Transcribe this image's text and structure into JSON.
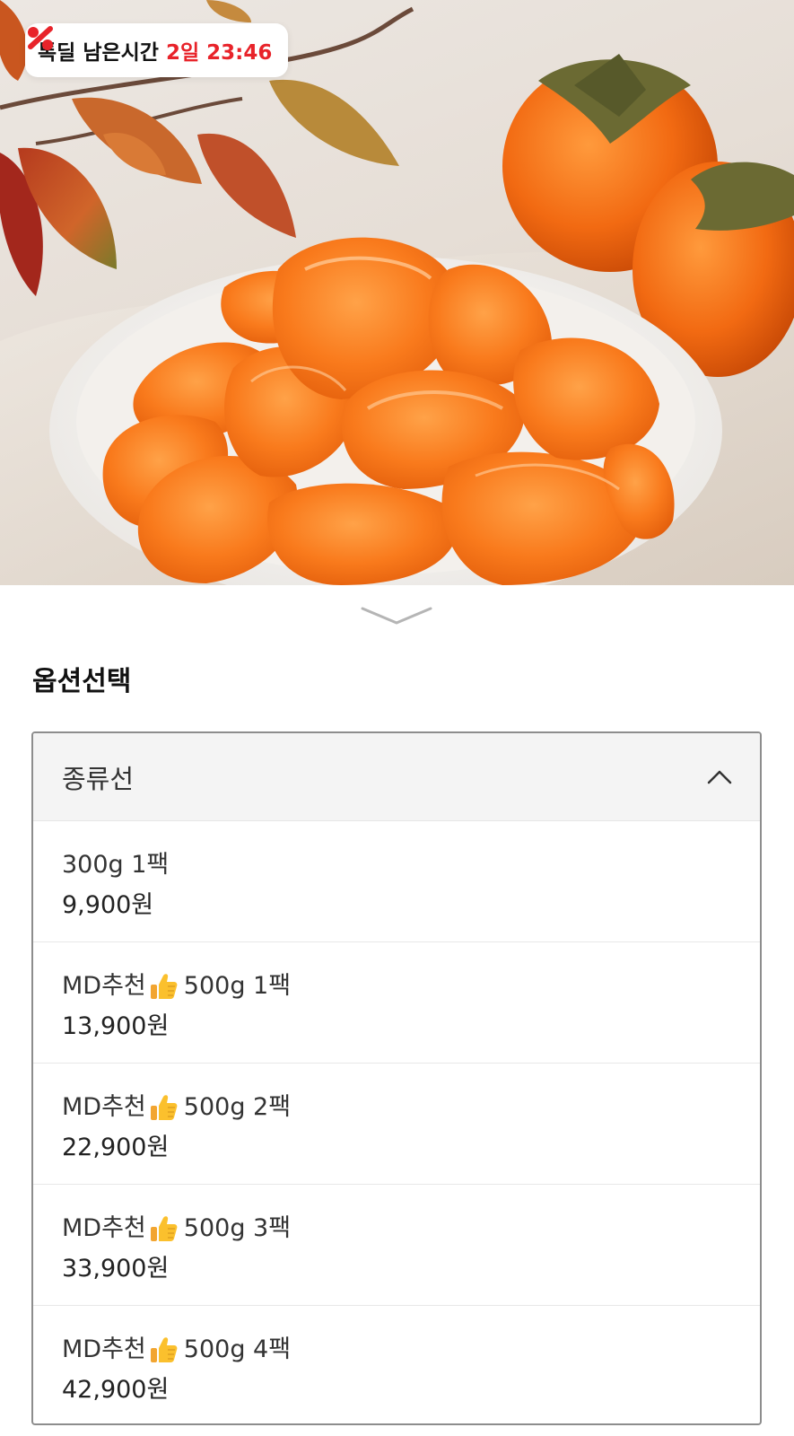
{
  "badge": {
    "label": "톡딜 남은시간",
    "time": "2일 23:46",
    "accent_color": "#e8232a",
    "icon": "percent-icon"
  },
  "expand_icon": "chevron-down-icon",
  "section_title": "옵션선택",
  "dropdown": {
    "label": "종류선",
    "icon": "chevron-up-icon",
    "options": [
      {
        "name_prefix": "",
        "has_thumb": false,
        "name_suffix": "300g 1팩",
        "price": "9,900원"
      },
      {
        "name_prefix": "MD추천",
        "has_thumb": true,
        "name_suffix": "500g 1팩",
        "price": "13,900원"
      },
      {
        "name_prefix": "MD추천",
        "has_thumb": true,
        "name_suffix": "500g 2팩",
        "price": "22,900원"
      },
      {
        "name_prefix": "MD추천",
        "has_thumb": true,
        "name_suffix": "500g 3팩",
        "price": "33,900원"
      },
      {
        "name_prefix": "MD추천",
        "has_thumb": true,
        "name_suffix": "500g 4팩",
        "price": "42,900원"
      }
    ]
  }
}
